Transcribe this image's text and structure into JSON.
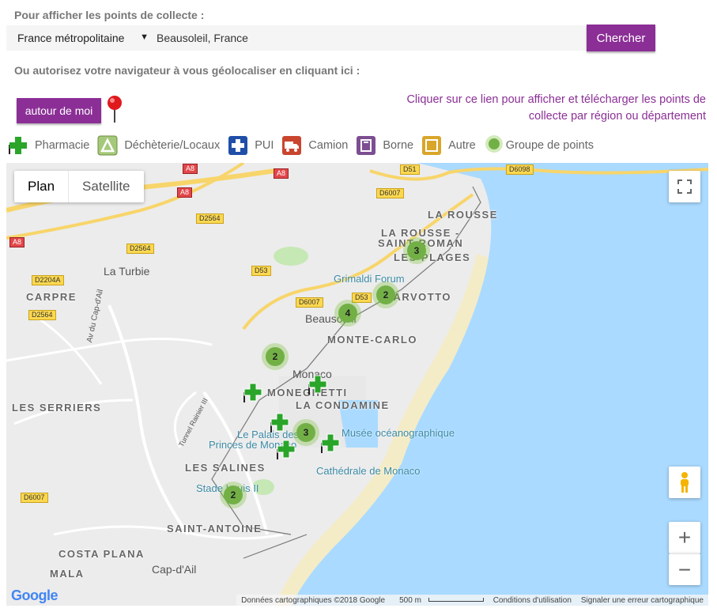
{
  "header": {
    "display_label": "Pour afficher les points de collecte :",
    "region_value": "France métropolitaine",
    "address_value": "Beausoleil, France",
    "search_label": "Chercher",
    "geoloc_label": "Ou autorisez votre navigateur à vous géolocaliser en cliquant ici :",
    "around_label": "autour de moi",
    "region_link": "Cliquer sur ce lien pour afficher et télécharger les points de collecte par région ou département"
  },
  "legend": [
    {
      "label": "Pharmacie",
      "icon": "pharmacy-cross-icon",
      "color": "#2aa52a"
    },
    {
      "label": "Déchèterie/Locaux",
      "icon": "recycle-site-icon",
      "color": "#7aa84a"
    },
    {
      "label": "PUI",
      "icon": "hospital-cross-icon",
      "color": "#1f4fa8"
    },
    {
      "label": "Camion",
      "icon": "truck-icon",
      "color": "#c9452e"
    },
    {
      "label": "Borne",
      "icon": "collection-bin-icon",
      "color": "#7d4e92"
    },
    {
      "label": "Autre",
      "icon": "other-point-icon",
      "color": "#d9a62a"
    },
    {
      "label": "Groupe de points",
      "icon": "cluster-icon",
      "color": "#72b046"
    }
  ],
  "map": {
    "type_plan": "Plan",
    "type_satellite": "Satellite",
    "footer": {
      "data": "Données cartographiques ©2018 Google",
      "scale": "500 m",
      "terms": "Conditions d'utilisation",
      "report": "Signaler une erreur cartographique"
    },
    "logo": "Google",
    "places": {
      "la_rousse": "LA ROUSSE",
      "la_rousse_sr1": "LA ROUSSE -",
      "la_rousse_sr2": "SAINT ROMAN",
      "les_plages": "LES PLAGES",
      "grimaldi": "Grimaldi Forum",
      "larvotto": "LARVOTTO",
      "la_turbie": "La Turbie",
      "carpre": "CARPRE",
      "beausoleil": "Beausoleil",
      "monte_carlo": "MONTE-CARLO",
      "monaco": "Monaco",
      "moneghetti": "MONEGHETTI",
      "la_condamine": "LA CONDAMINE",
      "les_serriers": "LES SERRIERS",
      "palais": "Le Palais des",
      "princes": "Princes de Monaco",
      "musee": "Musée océanographique",
      "cathedrale": "Cathédrale de Monaco",
      "les_salines": "LES SALINES",
      "stade": "Stade Louis II",
      "saint_antoine": "SAINT-ANTOINE",
      "costa_plana": "COSTA PLANA",
      "cap_dail": "Cap-d'Ail",
      "mala": "MALA",
      "av_cap_dail": "Av du Cap-d'Ail",
      "tunnel": "Tunnel Rainier III"
    },
    "roads": [
      "A8",
      "A8",
      "A8",
      "A8",
      "D2564",
      "D2564",
      "D2204A",
      "D2564",
      "D53",
      "D6007",
      "D53",
      "D6007",
      "D51",
      "D6098",
      "D6007"
    ],
    "clusters": [
      "3",
      "2",
      "4",
      "2",
      "3",
      "2"
    ]
  }
}
